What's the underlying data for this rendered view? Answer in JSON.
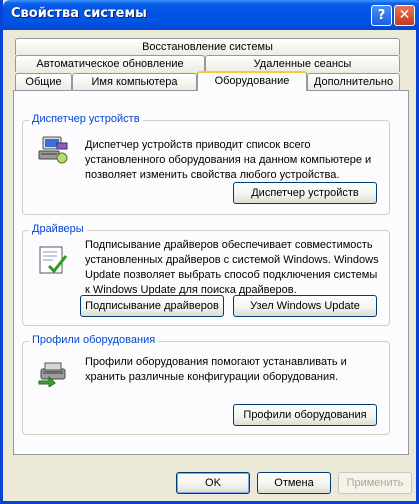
{
  "window": {
    "title": "Свойства системы"
  },
  "titlebar_buttons": {
    "help": "?",
    "close": "✕"
  },
  "tabs": {
    "row1": [
      {
        "label": "Восстановление системы"
      }
    ],
    "row2": [
      {
        "label": "Автоматическое обновление"
      },
      {
        "label": "Удаленные сеансы"
      }
    ],
    "row3": [
      {
        "label": "Общие"
      },
      {
        "label": "Имя компьютера"
      },
      {
        "label": "Оборудование",
        "active": true
      },
      {
        "label": "Дополнительно"
      }
    ]
  },
  "device_manager": {
    "title": "Диспетчер устройств",
    "description": [
      "Диспетчер устройств приводит список всего",
      "установленного оборудования на данном компьютере и",
      "позволяет изменить свойства любого устройства."
    ],
    "button": "Диспетчер устройств",
    "icon": "device-manager-icon"
  },
  "drivers": {
    "title": "Драйверы",
    "description": [
      "Подписывание драйверов обеспечивает совместимость",
      "установленных драйверов с системой Windows.  Windows",
      "Update позволяет выбрать способ подключения системы",
      "к Windows Update для поиска драйверов."
    ],
    "button_signing": "Подписывание драйверов",
    "button_update": "Узел Windows Update",
    "icon": "driver-signing-icon"
  },
  "hardware_profiles": {
    "title": "Профили оборудования",
    "description": [
      "Профили оборудования помогают устанавливать и",
      "хранить различные конфигурации оборудования."
    ],
    "button": "Профили оборудования",
    "icon": "hardware-profiles-icon"
  },
  "dialog_buttons": {
    "ok": "OK",
    "cancel": "Отмена",
    "apply": "Применить"
  },
  "colors": {
    "accent": "#0055e5",
    "group_title": "#0046d5",
    "tab_highlight": "#ffc83c"
  }
}
